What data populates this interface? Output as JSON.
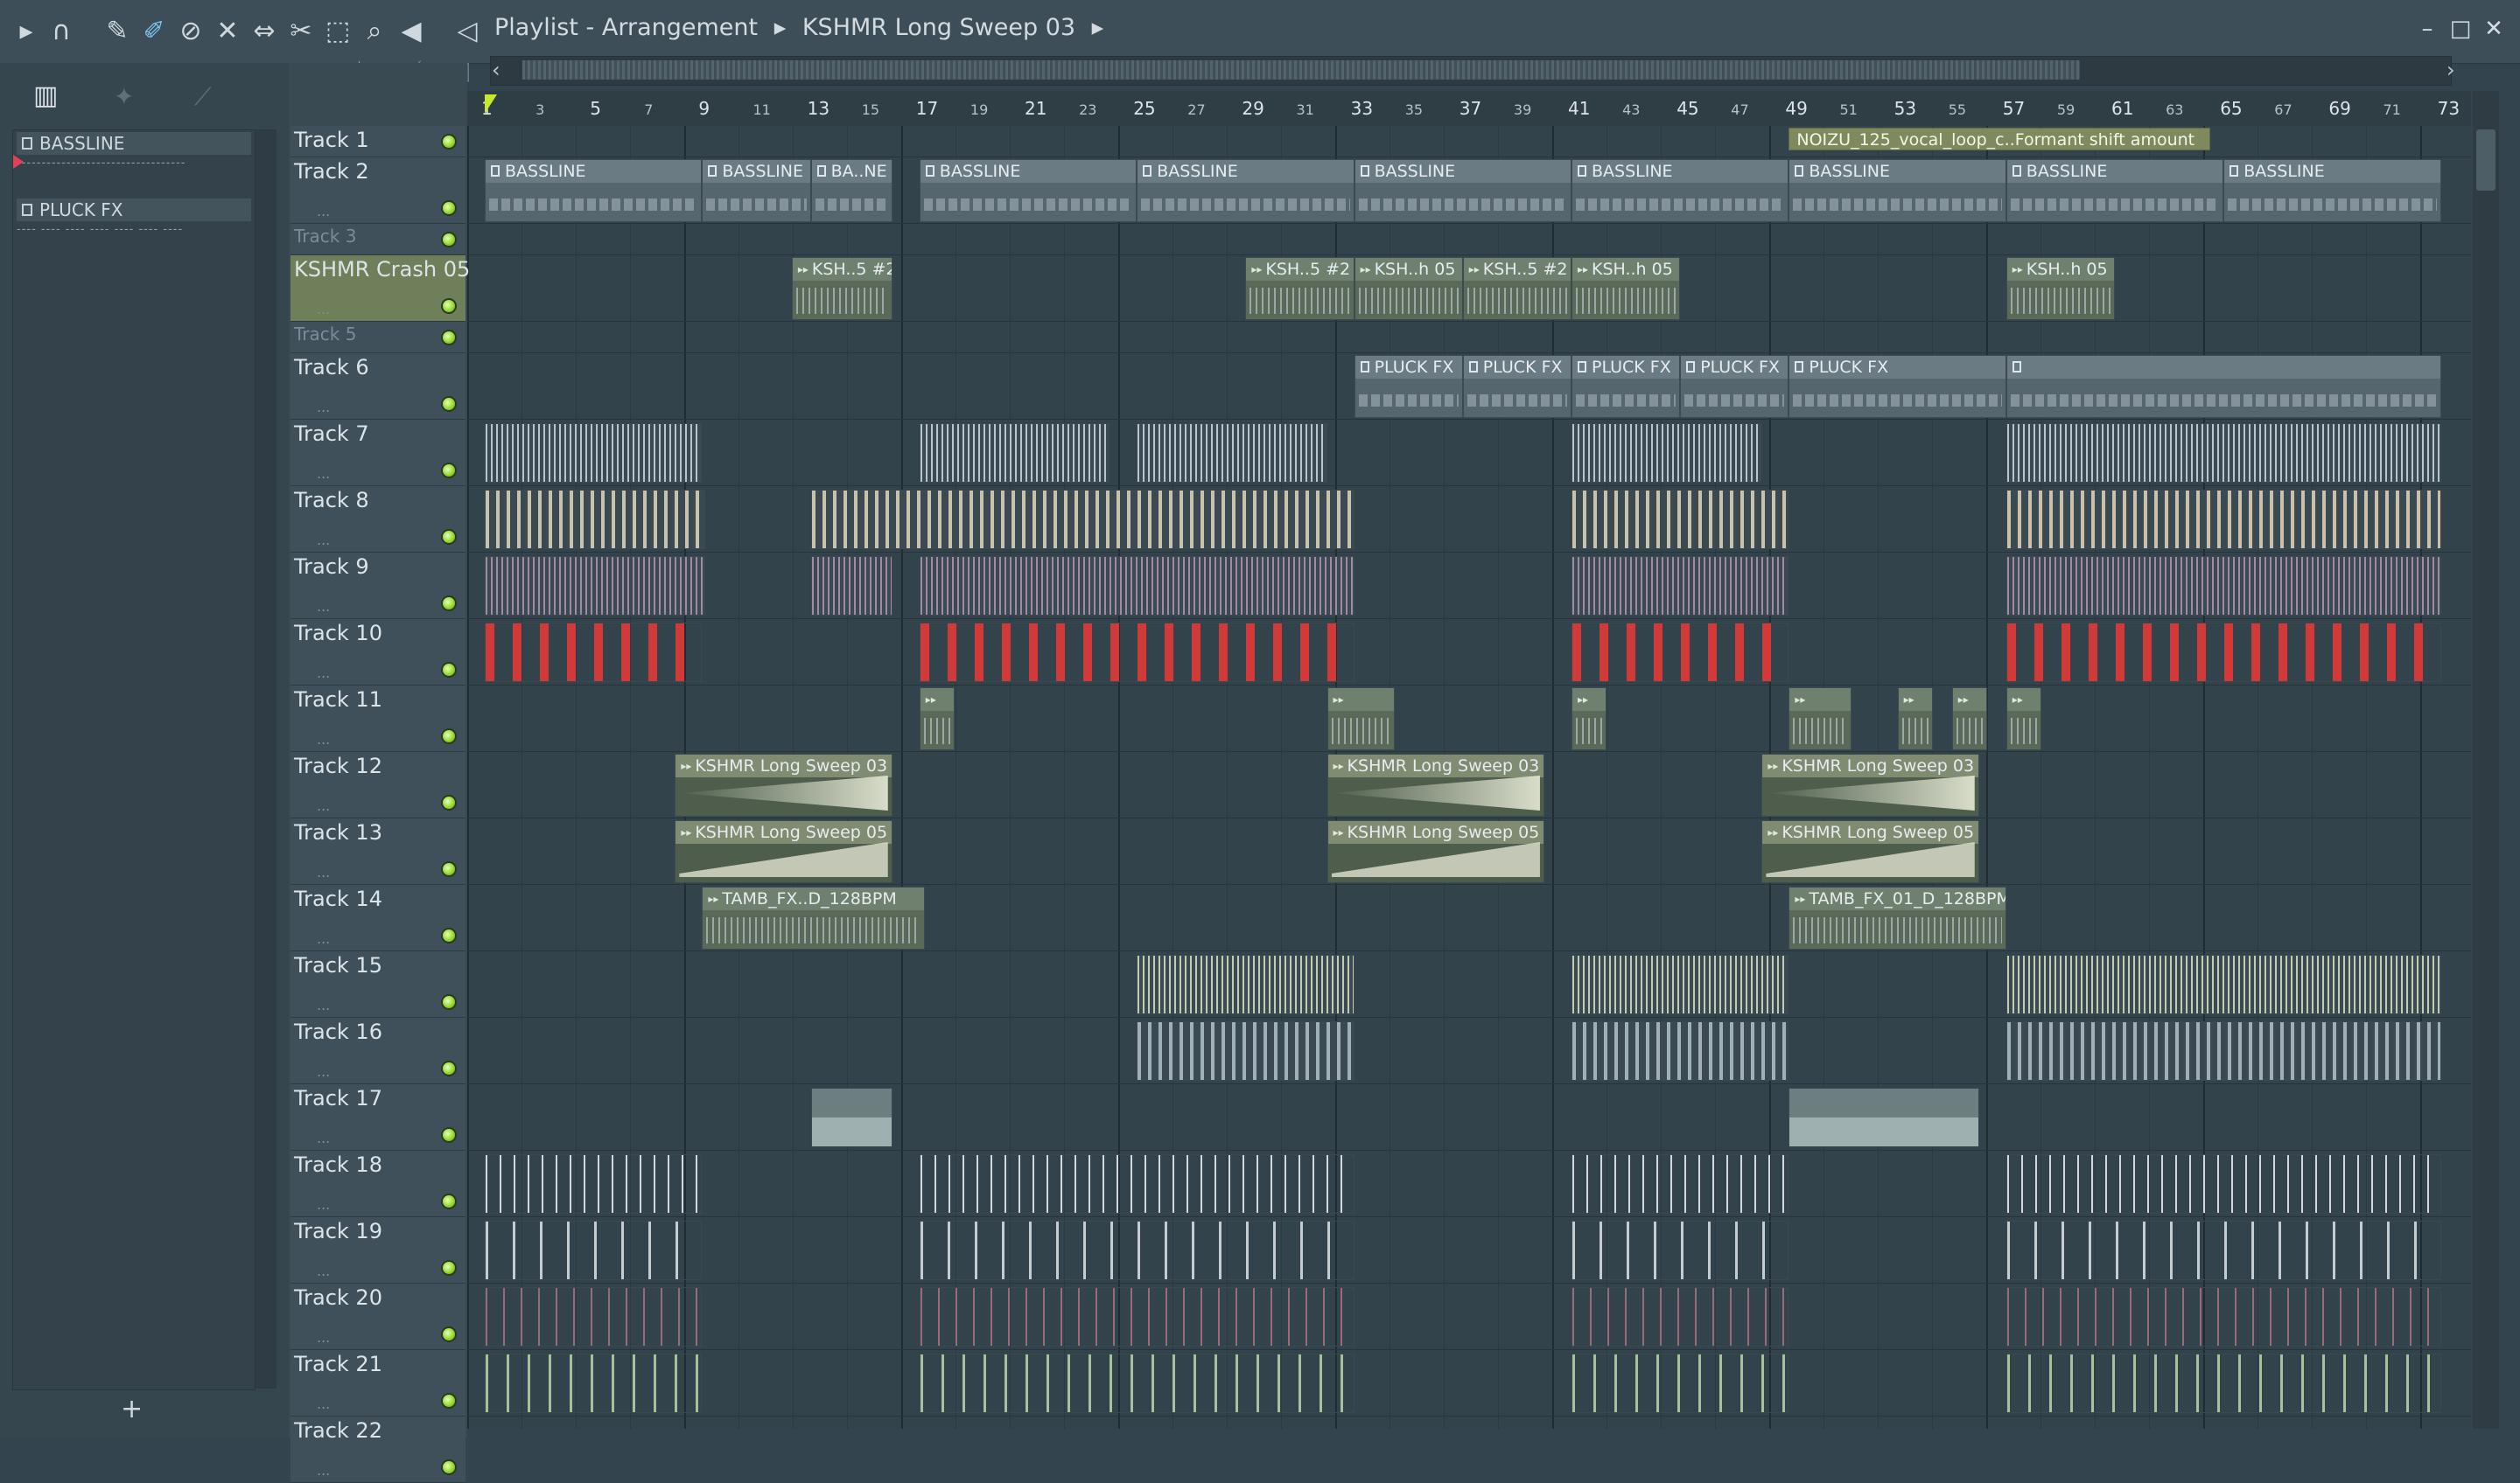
{
  "toolbar": {
    "title_parts": [
      "Playlist - Arrangement",
      "▸",
      "KSHMR Long Sweep 03",
      "▸"
    ],
    "icons": [
      "play-arrow-icon",
      "magnet-icon",
      "pencil-icon",
      "paint-brush-icon",
      "delete-icon",
      "mute-icon",
      "slip-icon",
      "slice-icon",
      "select-icon",
      "zoom-icon",
      "playback-icon",
      "speaker-icon"
    ],
    "window_buttons": [
      "–",
      "□",
      "✕"
    ]
  },
  "picker": {
    "items": [
      {
        "label": "BASSLINE",
        "preview": "‐‐‐‐‐‐‐‐‐‐‐‐‐‐‐‐‐‐‐‐‐‐‐‐‐‐‐‐‐‐‐‐‐‐"
      },
      {
        "label": "PLUCK FX",
        "preview": "‐‐‐‐ ‐‐‐‐ ‐‐‐‐ ‐‐‐‐ ‐‐‐‐ ‐‐‐‐ ‐‐‐‐"
      }
    ],
    "add_label": "+"
  },
  "tracks": [
    {
      "name": "Track 1",
      "h": 32,
      "dim": false
    },
    {
      "name": "Track 2",
      "h": 76,
      "dim": false
    },
    {
      "name": "Track 3",
      "h": 32,
      "dim": true
    },
    {
      "name": "KSHMR Crash 05",
      "h": 76,
      "dim": false
    },
    {
      "name": "Track 5",
      "h": 32,
      "dim": true
    },
    {
      "name": "Track 6",
      "h": 76,
      "dim": false
    },
    {
      "name": "Track 7",
      "h": 76,
      "dim": false
    },
    {
      "name": "Track 8",
      "h": 76,
      "dim": false
    },
    {
      "name": "Track 9",
      "h": 76,
      "dim": false
    },
    {
      "name": "Track 10",
      "h": 76,
      "dim": false
    },
    {
      "name": "Track 11",
      "h": 76,
      "dim": false
    },
    {
      "name": "Track 12",
      "h": 76,
      "dim": false
    },
    {
      "name": "Track 13",
      "h": 76,
      "dim": false
    },
    {
      "name": "Track 14",
      "h": 76,
      "dim": false
    },
    {
      "name": "Track 15",
      "h": 76,
      "dim": false
    },
    {
      "name": "Track 16",
      "h": 76,
      "dim": false
    },
    {
      "name": "Track 17",
      "h": 76,
      "dim": false
    },
    {
      "name": "Track 18",
      "h": 76,
      "dim": false
    },
    {
      "name": "Track 19",
      "h": 76,
      "dim": false
    },
    {
      "name": "Track 20",
      "h": 76,
      "dim": false
    },
    {
      "name": "Track 21",
      "h": 76,
      "dim": false
    },
    {
      "name": "Track 22",
      "h": 76,
      "dim": false
    }
  ],
  "ruler": {
    "major": [
      "1",
      "5",
      "9",
      "13",
      "17",
      "21",
      "25",
      "29",
      "33",
      "37",
      "41",
      "45",
      "49",
      "53",
      "57",
      "61",
      "65",
      "69",
      "73"
    ],
    "minor": [
      "3",
      "7",
      "11",
      "15",
      "19",
      "23",
      "27",
      "31",
      "35",
      "39",
      "43",
      "47",
      "51",
      "55",
      "59",
      "63",
      "67",
      "71"
    ]
  },
  "clips": {
    "bassline": [
      "BASSLINE",
      "BASSLINE",
      "BA..NE",
      "BASSLINE",
      "BASSLINE",
      "BASSLINE",
      "BASSLINE",
      "BASSLINE",
      "BASSLINE",
      "BASSLINE"
    ],
    "crash": [
      "KSH..5 #2",
      "KSH..5 #2",
      "KSH..h 05",
      "KSH..5 #2",
      "KSH..h 05",
      "KSH..h 05"
    ],
    "pluck": [
      "PLUCK FX",
      "PLUCK FX",
      "PLUCK FX",
      "PLUCK FX",
      "PLUCK FX"
    ],
    "sweep03": [
      "KSHMR Long Sweep 03",
      "KSHMR Long Sweep 03",
      "KSHMR Long Sweep 03"
    ],
    "sweep05": [
      "KSHMR Long Sweep 05",
      "KSHMR Long Sweep 05",
      "KSHMR Long Sweep 05"
    ],
    "tamb": [
      "TAMB_FX..D_128BPM",
      "TAMB_FX_01_D_128BPM"
    ],
    "automation": "NOIZU_125_vocal_loop_c..Formant shift amount"
  }
}
